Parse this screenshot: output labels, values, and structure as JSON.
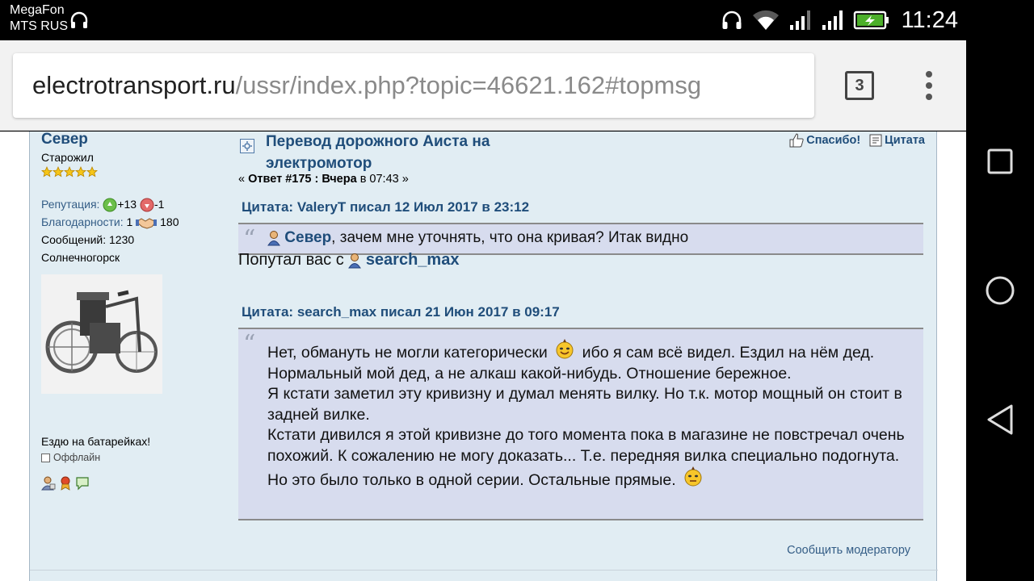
{
  "status_bar": {
    "carrier_1": "MegaFon",
    "carrier_2": "MTS RUS",
    "time": "11:24",
    "icons": [
      "headphones-icon",
      "wifi-icon",
      "signal-icon",
      "signal-icon",
      "battery-charging-icon"
    ]
  },
  "browser": {
    "url_domain": "electrotransport.ru",
    "url_path": "/ussr/index.php?topic=46621.162#topmsg",
    "tab_count": "3"
  },
  "poster": {
    "name": "Север",
    "rank": "Старожил",
    "stars_count": 5,
    "reputation_label": "Репутация:",
    "reputation_plus": "+13",
    "reputation_minus": "-1",
    "thanks_label": "Благодарности:",
    "thanks_given": "1",
    "thanks_received": "180",
    "messages": "Сообщений: 1230",
    "location": "Солнечногорск",
    "blurb": "Ездю на батарейках!",
    "online_status": "Оффлайн"
  },
  "post": {
    "subject_line_1": "Перевод дорожного Аиста на",
    "subject_line_2": "электромотор",
    "reply_prefix": "« ",
    "reply_number": "Ответ #175 : Вчера",
    "reply_time": " в 07:43 »",
    "thanks_action": "Спасибо!",
    "quote_action": "Цитата",
    "quote1_header": "Цитата: ValeryT писал 12 Июл 2017 в 23:12",
    "quote1_mention": "Север",
    "quote1_text": ", зачем мне уточнять, что она кривая? Итак видно",
    "line_text": "Попутал вас с ",
    "line_mention": "search_max",
    "quote2_header": "Цитата: search_max писал 21 Июн 2017 в 09:17",
    "quote2_p1_a": "Нет, обмануть не могли категорически",
    "quote2_p1_b": "ибо я сам всё видел. Ездил на нём дед. Нормальный мой дед, а не алкаш какой-нибудь. Отношение бережное.",
    "quote2_p2": "Я кстати заметил эту кривизну и думал менять вилку. Но т.к. мотор мощный он стоит в задней вилке.",
    "quote2_p3_a": "Кстати дивился я этой кривизне до того момента пока в магазине не повстречал очень похожий. К сожалению не могу доказать...  Т.е. передняя вилка специально подогнута. Но это было только в одной серии. Остальные прямые.",
    "report_link": "Сообщить модератору"
  }
}
